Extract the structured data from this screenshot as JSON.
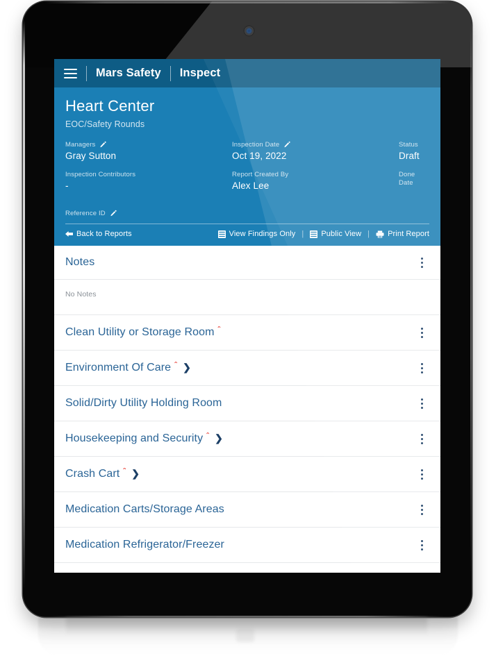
{
  "topbar": {
    "menu_icon": "hamburger-icon",
    "brand": "Mars Safety",
    "module": "Inspect"
  },
  "hero": {
    "title": "Heart Center",
    "subtitle": "EOC/Safety Rounds",
    "fields": [
      {
        "label": "Managers",
        "value": "Gray Sutton",
        "editable": true
      },
      {
        "label": "Inspection Date",
        "value": "Oct 19, 2022",
        "editable": true
      },
      {
        "label": "Status",
        "value": "Draft",
        "editable": false
      },
      {
        "label": "Inspection Contributors",
        "value": "-",
        "editable": false
      },
      {
        "label": "Report Created By",
        "value": "Alex Lee",
        "editable": false
      },
      {
        "label": "Done Date",
        "value": "",
        "editable": false
      }
    ],
    "reference_id_label": "Reference ID",
    "reference_id_value": ""
  },
  "actionbar": {
    "back_label": "Back to Reports",
    "back_icon": "arrow-left-icon",
    "actions": [
      {
        "label": "View Findings Only",
        "icon": "list-view-icon"
      },
      {
        "label": "Public View",
        "icon": "list-view-icon"
      },
      {
        "label": "Print Report",
        "icon": "printer-icon"
      }
    ],
    "separator": "|"
  },
  "notes_card": {
    "title": "Notes",
    "empty_text": "No Notes",
    "menu_icon": "kebab-menu-icon"
  },
  "sections": [
    {
      "label": "Clean Utility or Storage Room",
      "required": true,
      "has_chevron": false
    },
    {
      "label": "Environment Of Care",
      "required": true,
      "has_chevron": true
    },
    {
      "label": "Solid/Dirty Utility Holding Room",
      "required": false,
      "has_chevron": false
    },
    {
      "label": "Housekeeping and Security",
      "required": true,
      "has_chevron": true
    },
    {
      "label": "Crash Cart",
      "required": true,
      "has_chevron": true
    },
    {
      "label": "Medication Carts/Storage Areas",
      "required": false,
      "has_chevron": false
    },
    {
      "label": "Medication Refrigerator/Freezer",
      "required": false,
      "has_chevron": false
    }
  ],
  "colors": {
    "topbar": "#0e5c85",
    "hero": "#1b7fb5",
    "link": "#2a6496",
    "required": "#e8433a",
    "kebab": "#1c3f66",
    "muted": "#8a9097"
  }
}
